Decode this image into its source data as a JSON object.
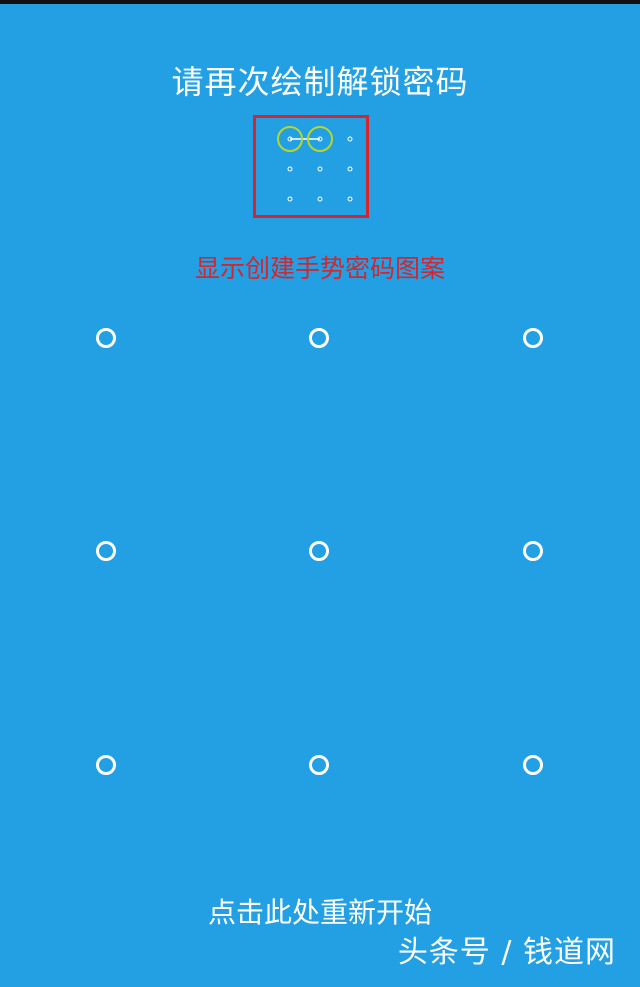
{
  "header": {
    "prompt": "请再次绘制解锁密码"
  },
  "preview": {
    "annotation": "显示创建手势密码图案",
    "selected_dots": [
      1,
      2
    ],
    "highlight_color": "#b8d62a",
    "box_color": "#d4262e"
  },
  "pattern_grid": {
    "rows": 3,
    "cols": 3
  },
  "footer": {
    "restart_label": "点击此处重新开始",
    "watermark": "头条号 / 钱道网"
  },
  "colors": {
    "background": "#22a0e3",
    "text": "#ffffff",
    "annotation": "#d4262e"
  }
}
